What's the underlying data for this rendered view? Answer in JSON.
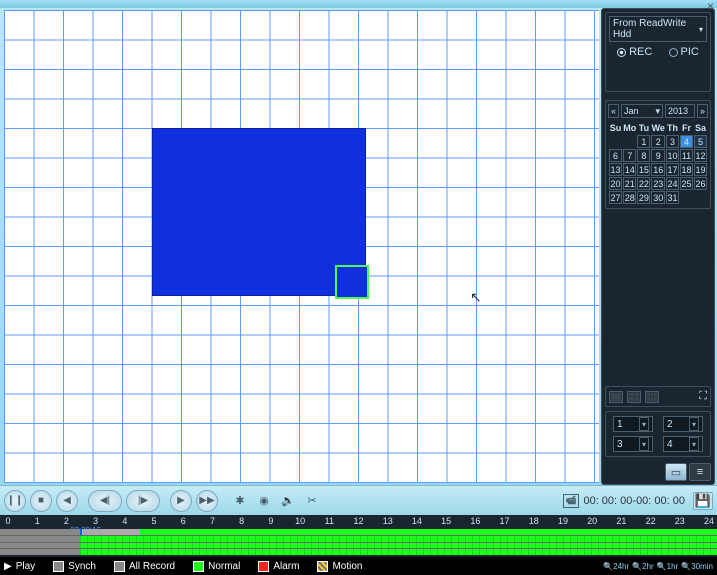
{
  "titlebar": {
    "close": "×"
  },
  "source_panel": {
    "dropdown_value": "From ReadWrite Hdd",
    "rec_label": "REC",
    "pic_label": "PIC"
  },
  "calendar": {
    "month": "Jan",
    "year": "2013",
    "prev": "«",
    "next": "»",
    "headers": [
      "Su",
      "Mo",
      "Tu",
      "We",
      "Th",
      "Fr",
      "Sa"
    ],
    "first_day_col": 2,
    "days_in_month": 31,
    "selected_fr": 4,
    "selected_sa": 5
  },
  "channel_selectors": [
    "1",
    "2",
    "3",
    "4"
  ],
  "playback": {
    "pause": "❙❙",
    "stop": "■",
    "prev": "◀",
    "step_back": "◀|",
    "step_fwd": "|▶",
    "play": "▶",
    "fwd": "▶▶",
    "smart": "✱",
    "snap": "◉",
    "vol": "🔈",
    "cut": "✂"
  },
  "time_display": {
    "start": "00: 00: 00",
    "end": "00: 00: 00",
    "sep": " - "
  },
  "ruler": {
    "hours": [
      "0",
      "1",
      "2",
      "3",
      "4",
      "5",
      "6",
      "7",
      "8",
      "9",
      "10",
      "11",
      "12",
      "13",
      "14",
      "15",
      "16",
      "17",
      "18",
      "19",
      "20",
      "21",
      "22",
      "23",
      "24"
    ],
    "pos_label": "02:38:15"
  },
  "legend": {
    "play": "Play",
    "synch": "Synch",
    "all_record": "All Record",
    "normal": "Normal",
    "alarm": "Alarm",
    "motion": "Motion"
  },
  "zoom": {
    "z24": "24hr",
    "z2": "2hr",
    "z1": "1hr",
    "z30": "30min"
  },
  "icons": {
    "dropdown_arrow": "▾",
    "camera": "📹",
    "save": "💾",
    "list": "≡",
    "card": "▭",
    "fullscreen": "⛶",
    "magnify": "🔍"
  }
}
